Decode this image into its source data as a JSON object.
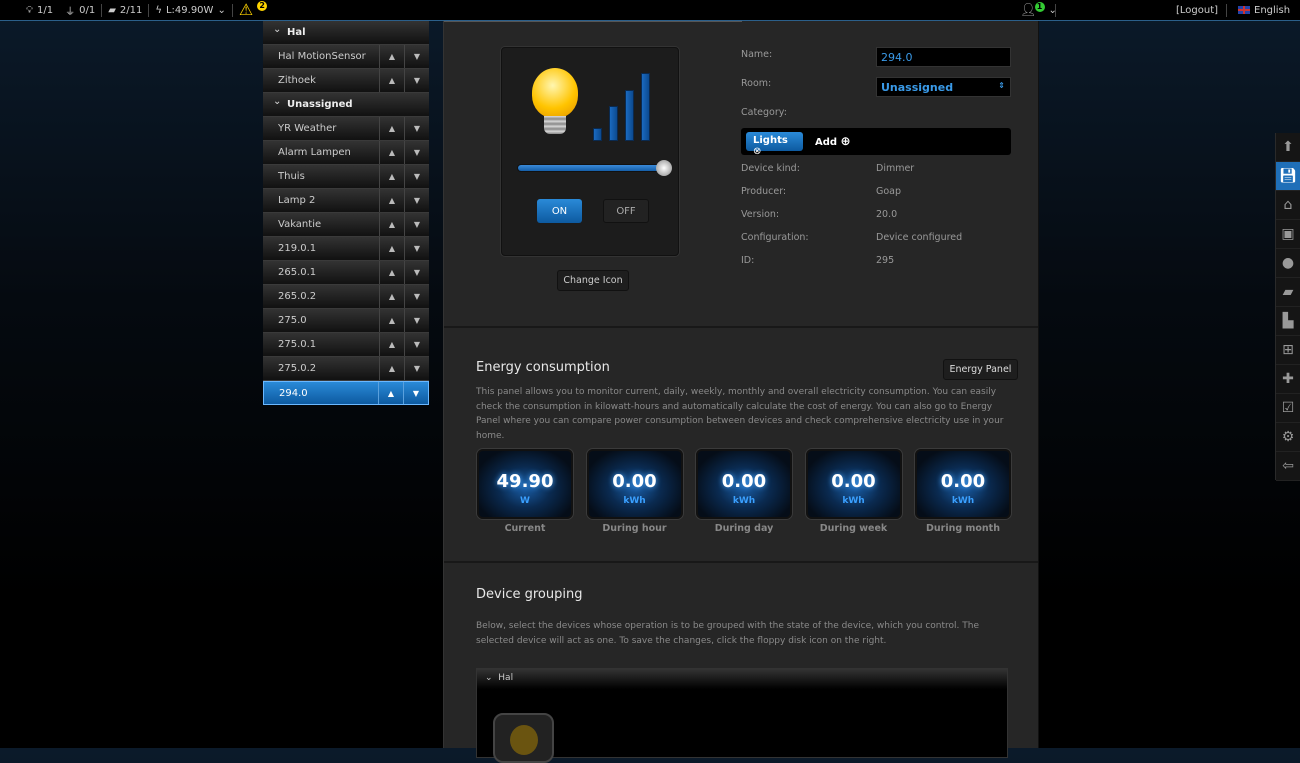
{
  "topbar": {
    "lights": "1/1",
    "plugs": "0/1",
    "scenes": "2/11",
    "power": "L:49.90W",
    "warnings": "2",
    "users": "1",
    "logout": "[Logout]",
    "language": "English"
  },
  "sidebar": {
    "rows": [
      {
        "label": "Hal",
        "type": "room"
      },
      {
        "label": "Hal MotionSensor",
        "type": "device"
      },
      {
        "label": "Zithoek",
        "type": "device"
      },
      {
        "label": "Unassigned",
        "type": "room"
      },
      {
        "label": "YR Weather",
        "type": "device"
      },
      {
        "label": "Alarm Lampen",
        "type": "device"
      },
      {
        "label": "Thuis",
        "type": "device"
      },
      {
        "label": "Lamp 2",
        "type": "device"
      },
      {
        "label": "Vakantie",
        "type": "device"
      },
      {
        "label": "219.0.1",
        "type": "device"
      },
      {
        "label": "265.0.1",
        "type": "device"
      },
      {
        "label": "265.0.2",
        "type": "device"
      },
      {
        "label": "275.0",
        "type": "device"
      },
      {
        "label": "275.0.1",
        "type": "device"
      },
      {
        "label": "275.0.2",
        "type": "device"
      },
      {
        "label": "294.0",
        "type": "device",
        "selected": true
      }
    ]
  },
  "device": {
    "on": "ON",
    "off": "OFF",
    "change_icon": "Change Icon",
    "dimmer_level": 1.0,
    "name_label": "Name:",
    "name_value": "294.0",
    "room_label": "Room:",
    "room_value": "Unassigned",
    "category_label": "Category:",
    "category_tag": "Lights",
    "add": "Add",
    "props": [
      {
        "k": "Device kind:",
        "v": "Dimmer"
      },
      {
        "k": "Producer:",
        "v": "Goap"
      },
      {
        "k": "Version:",
        "v": "20.0"
      },
      {
        "k": "Configuration:",
        "v": "Device configured"
      },
      {
        "k": "ID:",
        "v": "295"
      }
    ]
  },
  "energy": {
    "title": "Energy consumption",
    "panel_button": "Energy Panel",
    "description": "This panel allows you to monitor current, daily, weekly, monthly and overall electricity consumption. You can easily check the consumption in kilowatt-hours and automatically calculate the cost of energy. You can also go to Energy Panel where you can compare power consumption between devices and check comprehensive electricity use in your home.",
    "tiles": [
      {
        "value": "49.90",
        "unit": "W",
        "label": "Current"
      },
      {
        "value": "0.00",
        "unit": "kWh",
        "label": "During hour"
      },
      {
        "value": "0.00",
        "unit": "kWh",
        "label": "During day"
      },
      {
        "value": "0.00",
        "unit": "kWh",
        "label": "During week"
      },
      {
        "value": "0.00",
        "unit": "kWh",
        "label": "During month"
      }
    ]
  },
  "grouping": {
    "title": "Device grouping",
    "description": "Below, select the devices whose operation is to be grouped with the state of the device, which you control. The selected device will act as one. To save the changes, click the floppy disk icon on the right.",
    "room": "Hal"
  },
  "colors": {
    "accent": "#1f6fb8",
    "warning": "#ffd400"
  }
}
